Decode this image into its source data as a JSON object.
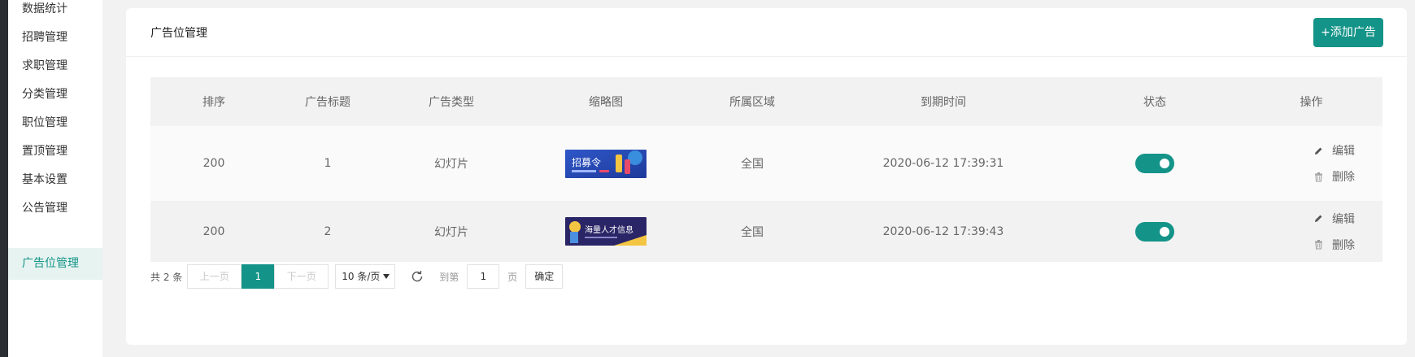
{
  "sidebar": {
    "items": [
      {
        "label": "数据统计"
      },
      {
        "label": "招聘管理"
      },
      {
        "label": "求职管理"
      },
      {
        "label": "分类管理"
      },
      {
        "label": "职位管理"
      },
      {
        "label": "置顶管理"
      },
      {
        "label": "基本设置"
      },
      {
        "label": "公告管理"
      },
      {
        "label": "广告位管理",
        "active": true
      }
    ]
  },
  "card": {
    "title": "广告位管理",
    "add_button": "+添加广告"
  },
  "table": {
    "columns": [
      "排序",
      "广告标题",
      "广告类型",
      "缩略图",
      "所属区域",
      "到期时间",
      "状态",
      "操作"
    ],
    "rows": [
      {
        "sort": "200",
        "title": "1",
        "type": "幻灯片",
        "thumb_text": "招募令",
        "region": "全国",
        "expire": "2020-06-12 17:39:31",
        "status_on": true,
        "edit": "编辑",
        "delete": "删除"
      },
      {
        "sort": "200",
        "title": "2",
        "type": "幻灯片",
        "thumb_text": "海量人才信息",
        "region": "全国",
        "expire": "2020-06-12 17:39:43",
        "status_on": true,
        "edit": "编辑",
        "delete": "删除"
      }
    ]
  },
  "pager": {
    "total": "共 2 条",
    "prev": "上一页",
    "current": "1",
    "next": "下一页",
    "page_size": "10 条/页",
    "goto_label": "到第",
    "goto_value": "1",
    "page_unit": "页",
    "confirm": "确定"
  },
  "colors": {
    "accent": "#149488",
    "sidebar_active_bg": "#e6f3f0"
  },
  "icons": [
    "edit-icon",
    "trash-icon",
    "refresh-icon",
    "caret-down-icon"
  ]
}
